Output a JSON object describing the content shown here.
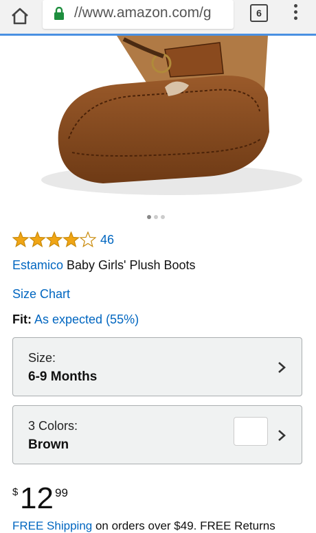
{
  "browser": {
    "url_text": "//www.amazon.com/g",
    "tab_count": "6"
  },
  "product": {
    "rating": 4,
    "rating_count": "46",
    "brand": "Estamico",
    "title_rest": " Baby Girls' Plush Boots",
    "size_chart": "Size Chart",
    "fit_label": "Fit:",
    "fit_value": "As expected (55%)",
    "image_dots": 3,
    "active_dot": 0
  },
  "selectors": {
    "size": {
      "label": "Size:",
      "value": "6-9 Months"
    },
    "color": {
      "label": "3 Colors:",
      "value": "Brown"
    }
  },
  "price": {
    "currency": "$",
    "whole": "12",
    "fraction": "99"
  },
  "shipping": {
    "link": "FREE Shipping",
    "rest": " on orders over $49. FREE Returns"
  },
  "colors": {
    "link": "#0066c0",
    "star": "#f0a515",
    "accent_bar": "#4a90e2"
  }
}
